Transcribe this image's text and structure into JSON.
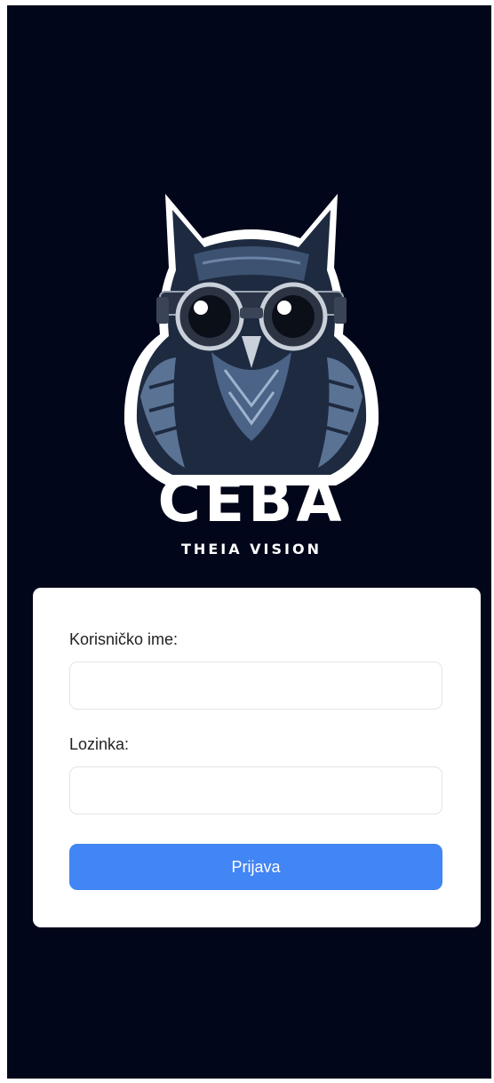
{
  "brand": {
    "name": "CEBA",
    "tagline": "THEIA VISION",
    "logo_icon": "owl-with-goggles-icon"
  },
  "login_form": {
    "username_label": "Korisničko ime:",
    "username_value": "",
    "password_label": "Lozinka:",
    "password_value": "",
    "submit_label": "Prijava"
  },
  "colors": {
    "background": "#02061a",
    "card": "#ffffff",
    "primary_button": "#4285f4"
  }
}
